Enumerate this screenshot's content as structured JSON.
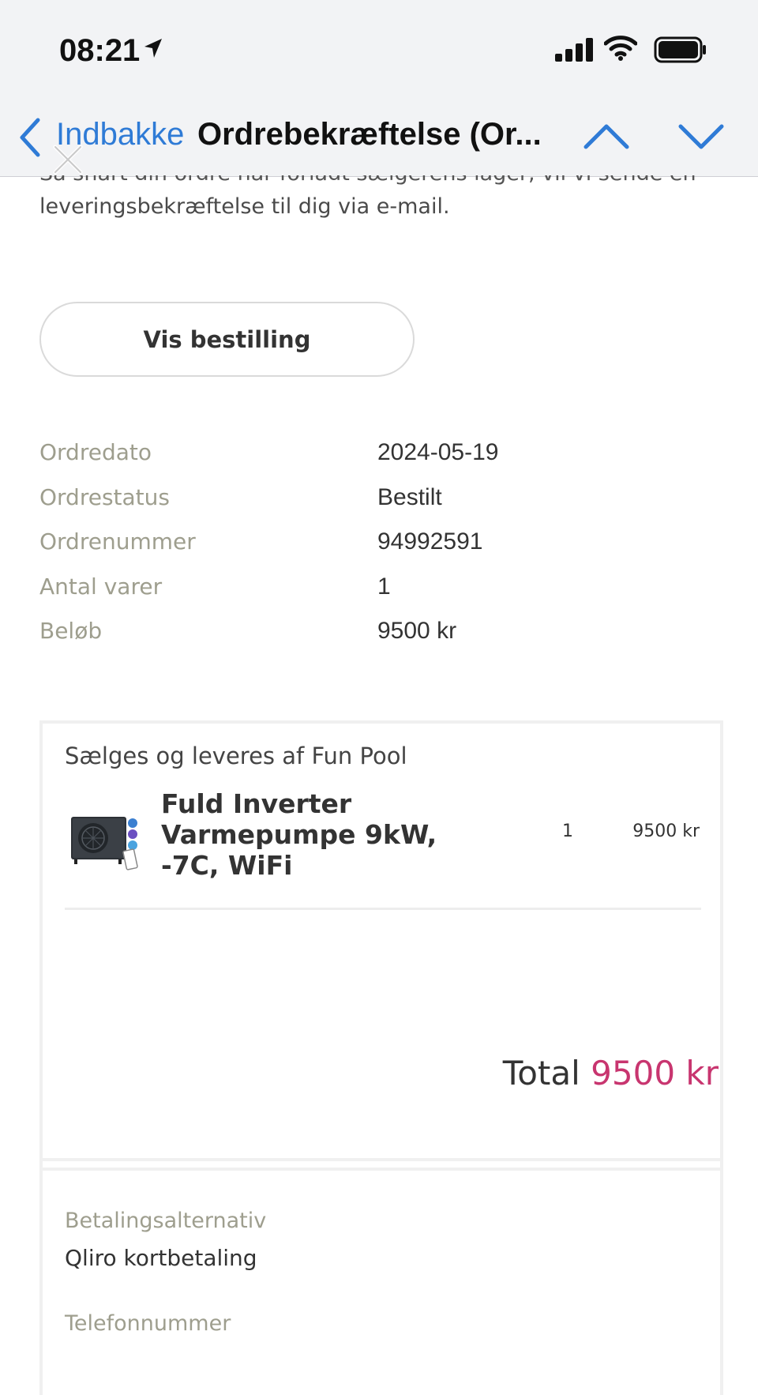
{
  "status_bar": {
    "time": "08:21"
  },
  "nav": {
    "back_label": "Indbakke",
    "subject": "Ordrebekræftelse (Or..."
  },
  "intro": {
    "cut_line": "Så snart din ordre har forladt sælgerens lager, vil vi sende en",
    "line": "leveringsbekræftelse til dig via e-mail."
  },
  "view_order_button": "Vis bestilling",
  "order_details": [
    {
      "label": "Ordredato",
      "value": "2024-05-19"
    },
    {
      "label": "Ordrestatus",
      "value": "Bestilt"
    },
    {
      "label": "Ordrenummer",
      "value": "94992591"
    },
    {
      "label": "Antal varer",
      "value": "1"
    },
    {
      "label": "Beløb",
      "value": "9500 kr"
    }
  ],
  "seller": {
    "title": "Sælges og leveres af Fun Pool",
    "product": {
      "name": "Fuld Inverter Varmepumpe 9kW, -7C, WiFi",
      "qty": "1",
      "price": "9500 kr"
    }
  },
  "total": {
    "label": "Total",
    "amount": "9500 kr"
  },
  "payment": {
    "label": "Betalingsalternativ",
    "value": "Qliro kortbetaling",
    "phone_label": "Telefonnummer"
  },
  "colors": {
    "accent_blue": "#2f7bd6",
    "total_pink": "#c8356f",
    "muted_label": "#9e9e8e"
  }
}
